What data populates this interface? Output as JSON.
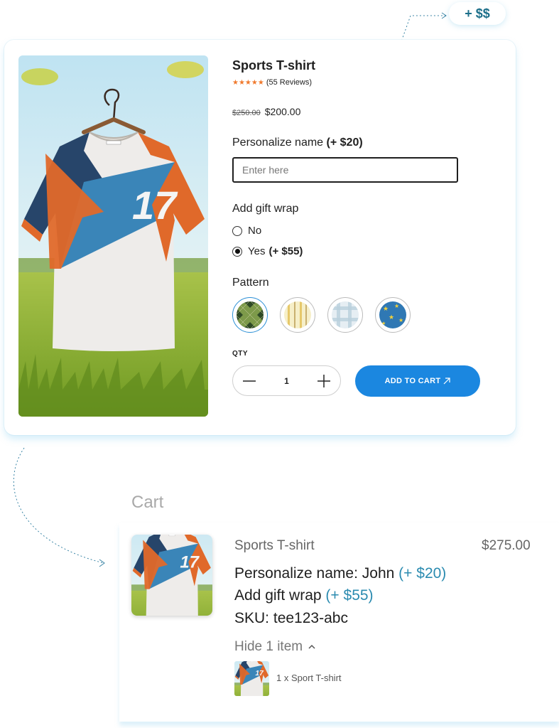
{
  "callout": {
    "label": "+ $$"
  },
  "product": {
    "title": "Sports T-shirt",
    "stars": "★★★★★",
    "reviews": "(55 Reviews)",
    "old_price": "$250.00",
    "price": "$200.00",
    "jersey_number": "17",
    "personalize": {
      "label": "Personalize name",
      "extra": "(+ $20)",
      "placeholder": "Enter here"
    },
    "gift_wrap": {
      "label": "Add gift wrap",
      "options": [
        {
          "label": "No",
          "extra": "",
          "checked": false
        },
        {
          "label": "Yes",
          "extra": "(+ $55)",
          "checked": true
        }
      ]
    },
    "pattern": {
      "label": "Pattern",
      "swatches": [
        "green-argyle",
        "cream-stripes",
        "blue-plaid",
        "blue-stars"
      ],
      "selected_index": 0
    },
    "qty": {
      "label": "QTY",
      "value": "1"
    },
    "add_to_cart": "ADD TO CART",
    "add_to_cart_icon": "arrow-up-right-icon"
  },
  "cart": {
    "title": "Cart",
    "item": {
      "name": "Sports T-shirt",
      "price": "$275.00",
      "personalize_label": "Personalize name:",
      "personalize_value": "John",
      "personalize_extra": "(+ $20)",
      "gift_wrap_label": "Add gift wrap",
      "gift_wrap_extra": "(+ $55)",
      "sku_label": "SKU:",
      "sku_value": "tee123-abc",
      "hide_items": "Hide 1 item",
      "hide_icon": "chevron-up-icon",
      "sub_item": "1 x Sport T-shirt"
    }
  },
  "colors": {
    "accent": "#1b87e0",
    "callout_text": "#1c6f8a",
    "cart_extra": "#2b8bb0",
    "stars": "#f07a2e"
  }
}
